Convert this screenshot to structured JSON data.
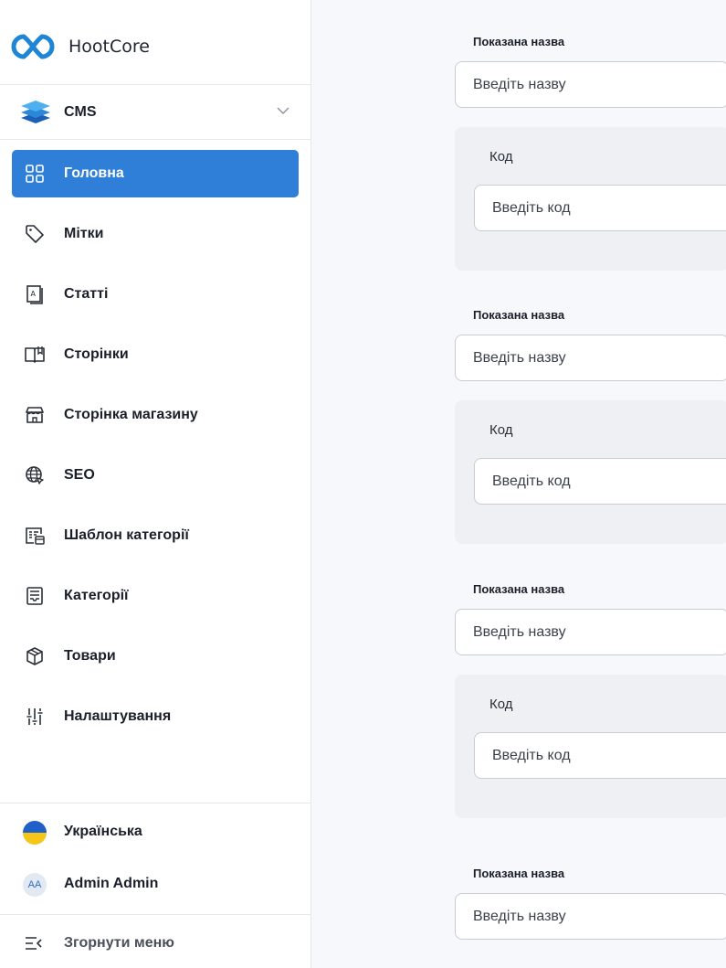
{
  "app": {
    "name": "HootCore"
  },
  "module_selector": {
    "label": "CMS"
  },
  "nav": {
    "items": [
      {
        "label": "Головна",
        "icon": "grid-icon",
        "active": true
      },
      {
        "label": "Мітки",
        "icon": "tag-icon"
      },
      {
        "label": "Статті",
        "icon": "article-icon"
      },
      {
        "label": "Сторінки",
        "icon": "book-icon"
      },
      {
        "label": "Сторінка магазину",
        "icon": "store-icon"
      },
      {
        "label": "SEO",
        "icon": "globe-cursor-icon"
      },
      {
        "label": "Шаблон категорії",
        "icon": "template-icon"
      },
      {
        "label": "Категорії",
        "icon": "categories-icon"
      },
      {
        "label": "Товари",
        "icon": "box-icon"
      },
      {
        "label": "Налаштування",
        "icon": "sliders-icon"
      }
    ]
  },
  "footer": {
    "language": "Українська",
    "user": {
      "initials": "AA",
      "name": "Admin Admin"
    },
    "collapse_label": "Згорнути меню"
  },
  "form": {
    "groups": [
      {
        "name_label": "Показана назва",
        "name_placeholder": "Введіть назву",
        "code_label": "Код",
        "code_placeholder": "Введіть код"
      },
      {
        "name_label": "Показана назва",
        "name_placeholder": "Введіть назву",
        "code_label": "Код",
        "code_placeholder": "Введіть код"
      },
      {
        "name_label": "Показана назва",
        "name_placeholder": "Введіть назву",
        "code_label": "Код",
        "code_placeholder": "Введіть код"
      },
      {
        "name_label": "Показана назва",
        "name_placeholder": "Введіть назву"
      }
    ]
  },
  "colors": {
    "accent": "#2f7fd8",
    "logo": "#1f86d6",
    "flag_blue": "#1e5fc8",
    "flag_yellow": "#f5c518"
  }
}
